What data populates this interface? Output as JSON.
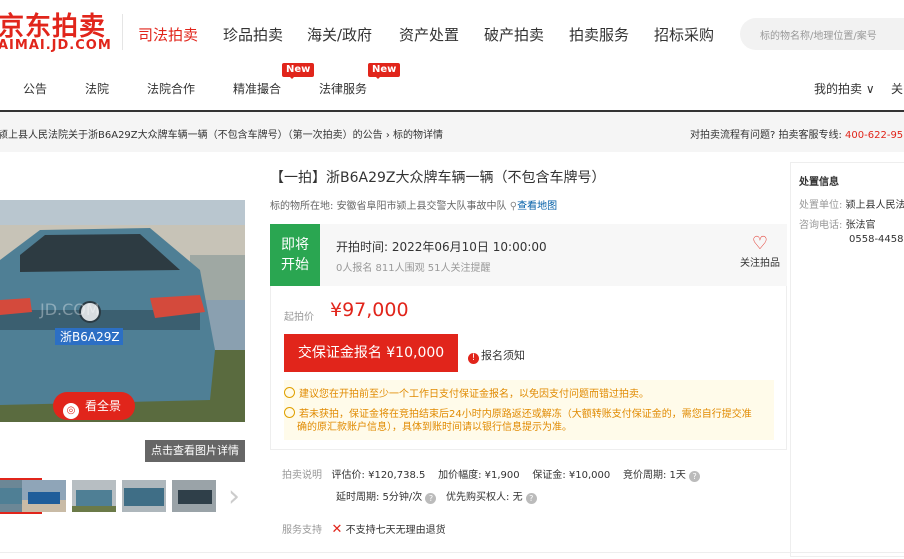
{
  "header": {
    "logo_cn": "京东拍卖",
    "logo_en": "AIMAI.JD.COM",
    "nav": [
      "司法拍卖",
      "珍品拍卖",
      "海关/政府",
      "资产处置",
      "破产拍卖",
      "拍卖服务",
      "招标采购"
    ],
    "search_placeholder": "标的物名称/地理位置/案号"
  },
  "subnav": {
    "items": [
      "公告",
      "法院",
      "法院合作",
      "精准撮合",
      "法律服务"
    ],
    "badge_new": "New",
    "my_auction": "我的拍卖 ∨",
    "extra": "关"
  },
  "breadcrumb": {
    "text": "颍上县人民法院关于浙B6A29Z大众牌车辆一辆（不包含车牌号）（第一次拍卖）的公告 › 标的物详情",
    "help_prefix": "对拍卖流程有问题? 拍卖客服专线: ",
    "help_phone": "400-622-95"
  },
  "gallery": {
    "plate": "浙B6A29Z",
    "watermark": "JD.COM",
    "panorama_label": "看全景",
    "detail_label": "点击查看图片详情",
    "arrow": "›"
  },
  "item": {
    "title": "【一拍】浙B6A29Z大众牌车辆一辆（不包含车牌号）",
    "location_label": "标的物所在地: ",
    "location": "安徽省阜阳市颍上县交警大队事故中队",
    "map_link": "查看地图",
    "status_line1": "即将",
    "status_line2": "开始",
    "start_time": "开拍时间: 2022年06月10日 10:00:00",
    "stats": "0人报名   811人围观   51人关注提醒",
    "follow": "关注拍品",
    "start_price_label": "起拍价",
    "start_price": "¥97,000",
    "deposit_button": "交保证金报名 ¥10,000",
    "notice": "报名须知",
    "tip1": "建议您在开拍前至少一个工作日支付保证金报名，以免因支付问题而错过拍卖。",
    "tip2a": "若未获拍，保证金将在竞拍结束后24小时内原路返还或解冻（大额转账支付保证金的，需您自行提交准",
    "tip2b": "确的原汇款账户信息），具体到账时间请以银行信息提示为准。",
    "desc_label": "拍卖说明",
    "appraisal": "评估价: ¥120,738.5",
    "increment": "加价幅度: ¥1,900",
    "deposit": "保证金: ¥10,000",
    "cycle": "竞价周期: 1天",
    "delay": "延时周期: 5分钟/次",
    "priority": "优先购买权人: 无",
    "service_label": "服务支持",
    "service": "不支持七天无理由退货"
  },
  "side": {
    "title": "处置信息",
    "unit_label": "处置单位: ",
    "unit": "颍上县人民法",
    "contact_label": "咨询电话: ",
    "contact_name": "张法官",
    "contact_phone": "0558-44589"
  },
  "colors": {
    "brand": "#e1251b",
    "green": "#2aa651",
    "tip": "#e08a00",
    "link": "#005ea7"
  }
}
